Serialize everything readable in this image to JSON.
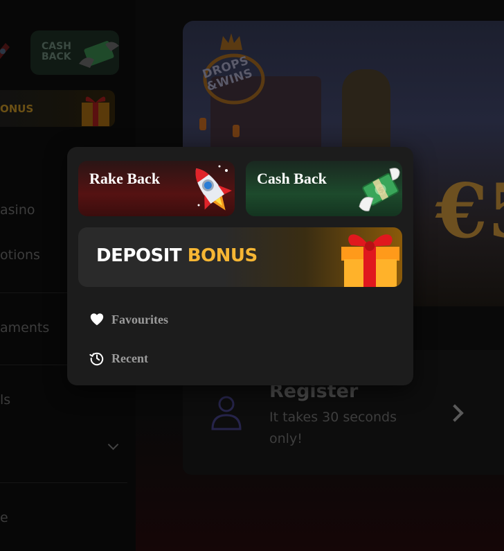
{
  "background": {
    "sidebar": {
      "cashback_tile_text": "CASH BACK",
      "bonus_tile_text": "ONUS",
      "nav_items": [
        "asino",
        "otions",
        "aments",
        "ls",
        "e"
      ]
    },
    "banner": {
      "logo_text": "DROPS &WINS",
      "big_text": "€5"
    },
    "register_card": {
      "title": "Register",
      "subtitle": "It takes 30 seconds only!"
    }
  },
  "popup": {
    "tiles": {
      "rakeback_label": "Rake Back",
      "cashback_label": "Cash Back"
    },
    "deposit_bonus": {
      "word_white": "DEPOSIT",
      "word_yellow": "BONUS"
    },
    "menu": {
      "favourites_label": "Favourites",
      "recent_label": "Recent"
    }
  },
  "colors": {
    "popup_bg": "#1c1c1c",
    "accent_yellow": "#f6b634",
    "rakeback_red": "#551212",
    "cashback_green": "#1d4a2c"
  }
}
